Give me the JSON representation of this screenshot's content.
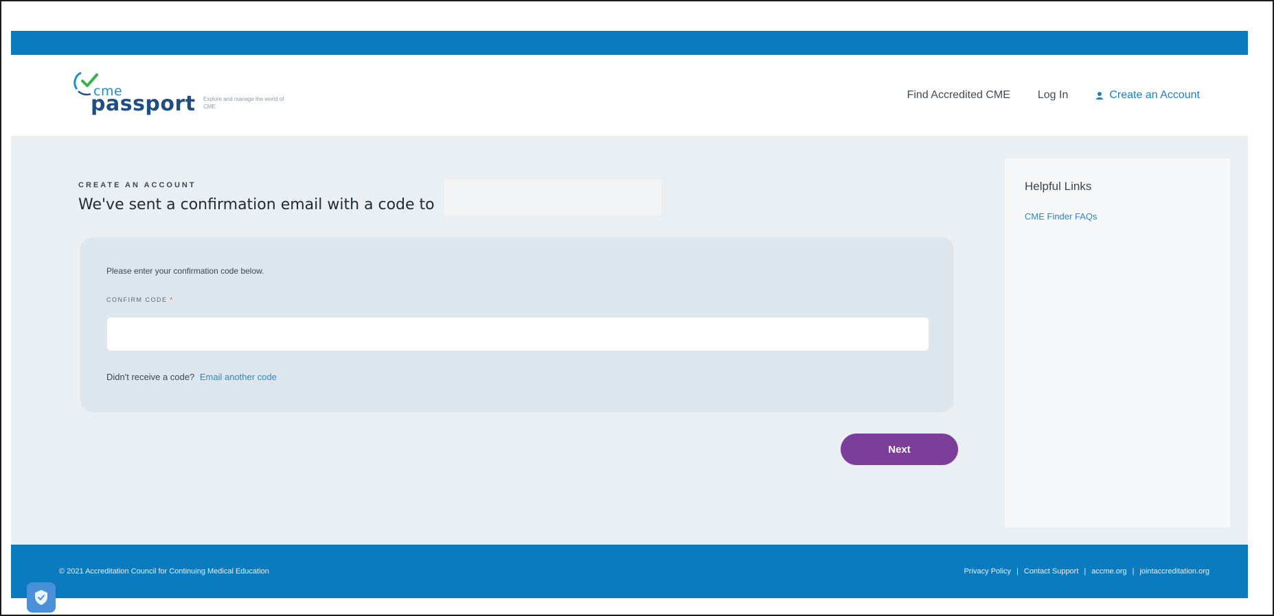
{
  "brand": {
    "cme": "cme",
    "passport": "passport",
    "tagline": "Explore and manage the world of CME"
  },
  "nav": {
    "find": "Find Accredited CME",
    "login": "Log In",
    "create": "Create an Account"
  },
  "page": {
    "eyebrow": "CREATE AN ACCOUNT",
    "heading": "We've sent a confirmation email with a code to"
  },
  "form": {
    "instruction": "Please enter your confirmation code below.",
    "label": "CONFIRM CODE",
    "required_mark": "*",
    "code_value": "",
    "resend_text": "Didn't receive a code?",
    "resend_link": "Email another code"
  },
  "actions": {
    "next": "Next"
  },
  "sidebar": {
    "title": "Helpful Links",
    "links": [
      "CME Finder FAQs"
    ]
  },
  "footer": {
    "copyright": "© 2021 Accreditation Council for Continuing Medical Education",
    "links": [
      "Privacy Policy",
      "Contact Support",
      "accme.org",
      "jointaccreditation.org"
    ],
    "separator": "|"
  },
  "colors": {
    "brand_blue": "#0a7bbf",
    "button_purple": "#7b3f9a",
    "link_blue": "#2b87c8"
  }
}
